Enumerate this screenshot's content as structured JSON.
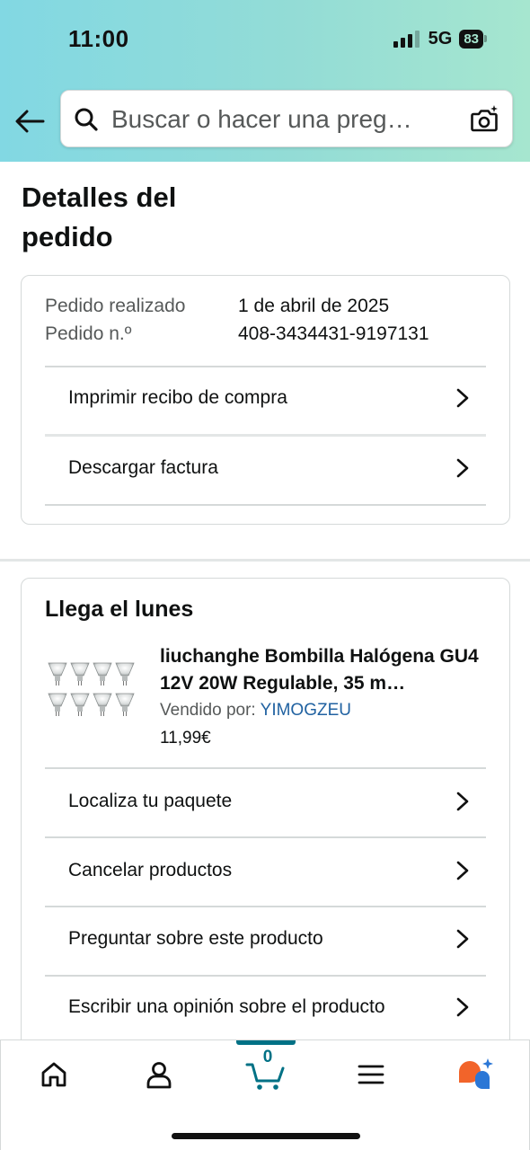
{
  "status_bar": {
    "time": "11:00",
    "network": "5G",
    "battery": "83"
  },
  "search": {
    "placeholder": "Buscar o hacer una preg…"
  },
  "page": {
    "title": "Detalles del pedido"
  },
  "order": {
    "placed_label": "Pedido realizado",
    "placed_value": "1 de abril de 2025",
    "number_label": "Pedido n.º",
    "number_value": "408-3434431-9197131",
    "actions": [
      {
        "label": "Imprimir recibo de compra"
      },
      {
        "label": "Descargar factura"
      }
    ]
  },
  "delivery": {
    "title": "Llega el lunes",
    "product": {
      "title": "liuchanghe Bombilla Halógena GU4 12V 20W Regulable, 35 m…",
      "seller_label": "Vendido por:",
      "seller_name": "YIMOGZEU",
      "price": "11,99€"
    },
    "actions": [
      {
        "label": "Localiza tu paquete"
      },
      {
        "label": "Cancelar productos"
      },
      {
        "label": "Preguntar sobre este producto"
      },
      {
        "label": "Escribir una opinión sobre el producto"
      }
    ]
  },
  "nav": {
    "items": [
      "home-icon",
      "account-icon",
      "cart-icon",
      "menu-icon",
      "rufus-icon"
    ],
    "cart_count": "0",
    "accent": "#007185"
  },
  "colors": {
    "link": "#2162a1",
    "header_gradient_start": "#82d8e3",
    "header_gradient_end": "#a6e6cf"
  }
}
